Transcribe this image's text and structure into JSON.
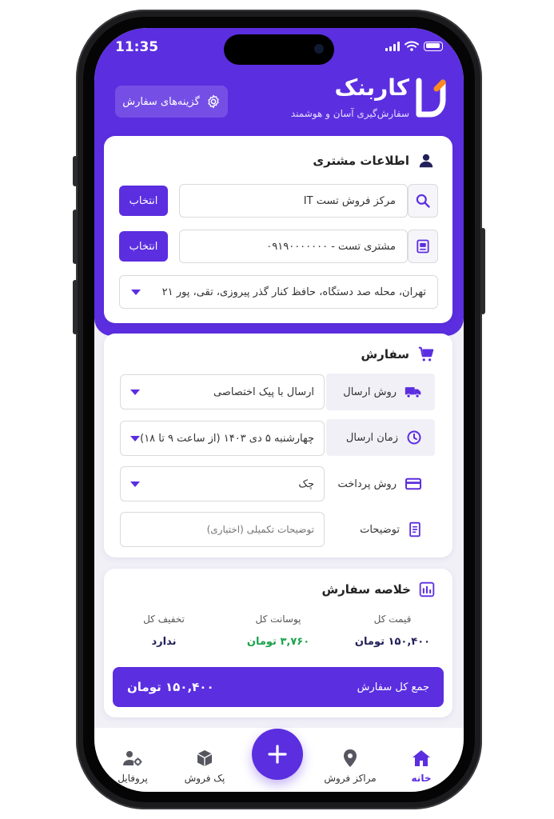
{
  "status_bar": {
    "time": "11:35"
  },
  "brand": {
    "name": "کاربنک",
    "tagline": "سفارش‌گیری آسان و هوشمند"
  },
  "header": {
    "options_button": "گزینه‌های سفارش"
  },
  "customer": {
    "title": "اطلاعات مشتری",
    "sales_center_value": "مرکز فروش تست IT",
    "customer_value": "مشتری تست - ۰۹۱۹۰۰۰۰۰۰۰",
    "select_label": "انتخاب",
    "address_value": "تهران، محله صد دستگاه، حافظ کنار گذر پیروزی، تقی، پور ۲۱"
  },
  "order": {
    "title": "سفارش",
    "rows": [
      {
        "label": "روش ارسال",
        "icon": "truck-icon",
        "value": "ارسال با پیک اختصاصی"
      },
      {
        "label": "زمان ارسال",
        "icon": "clock-icon",
        "value": "چهارشنبه ۵ دی ۱۴۰۳ (از ساعت ۹ تا ۱۸)"
      },
      {
        "label": "روش پرداخت",
        "icon": "card-icon",
        "value": "چک"
      },
      {
        "label": "توضیحات",
        "icon": "notes-icon",
        "placeholder": "توضیحات تکمیلی (اختیاری)"
      }
    ]
  },
  "summary": {
    "title": "خلاصه سفارش",
    "total_price_label": "قیمت کل",
    "total_price_value": "۱۵۰,۴۰۰ تومان",
    "commission_label": "پوسانت کل",
    "commission_value": "۳,۷۶۰ تومان",
    "discount_label": "تخفیف کل",
    "discount_value": "ندارد",
    "grand_total_label": "جمع کل سفارش",
    "grand_total_value": "۱۵۰,۴۰۰ تومان"
  },
  "nav": {
    "home": "خانه",
    "centers": "مراکز فروش",
    "peyk": "پک فروش",
    "profile": "پروفایل"
  },
  "colors": {
    "accent": "#5b2ee0",
    "positive": "#1aa34a",
    "heading": "#22205a",
    "logo_orange": "#ff8a1e"
  }
}
